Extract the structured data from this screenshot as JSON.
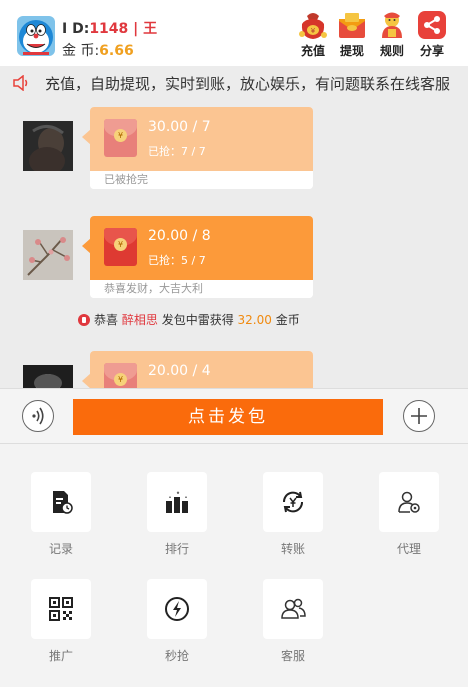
{
  "header": {
    "id_label": "I D:",
    "id_value": "1148",
    "separator": "|",
    "name": "王",
    "coins_label": "金 币:",
    "coins_value": "6.66",
    "buttons": [
      {
        "label": "充值",
        "icon": "recharge-bag-icon"
      },
      {
        "label": "提现",
        "icon": "withdraw-envelope-icon"
      },
      {
        "label": "规则",
        "icon": "rules-character-icon"
      },
      {
        "label": "分享",
        "icon": "share-icon"
      }
    ]
  },
  "marquee": {
    "icon": "speaker-icon",
    "text": "充值，自助提现，实时到账，放心娱乐，有问题联系在线客服"
  },
  "messages": [
    {
      "amount": "30.00 / 7",
      "grabbed": "已抢：7 / 7",
      "status": "已被抢完"
    },
    {
      "amount": "20.00 / 8",
      "grabbed": "已抢：5 / 7",
      "status": "恭喜发财，大吉大利"
    },
    {
      "amount": "20.00 / 4"
    }
  ],
  "notice": {
    "prefix": "恭喜",
    "name": "醉相思",
    "middle": "发包中雷获得",
    "amount": "32.00",
    "suffix": "金币"
  },
  "sendbar": {
    "send_label": "点击发包"
  },
  "menu": [
    {
      "label": "记录",
      "icon": "record-icon"
    },
    {
      "label": "排行",
      "icon": "ranking-icon"
    },
    {
      "label": "转账",
      "icon": "transfer-icon"
    },
    {
      "label": "代理",
      "icon": "agent-icon"
    },
    {
      "label": "推广",
      "icon": "qrcode-icon"
    },
    {
      "label": "秒抢",
      "icon": "lightning-icon"
    },
    {
      "label": "客服",
      "icon": "customer-service-icon"
    }
  ],
  "colors": {
    "accent": "#fa6b0c",
    "bubble_light": "#fbc592",
    "bubble_orange": "#fc9a3a",
    "highlight_red": "#e0383e",
    "coin_gold": "#f0a020"
  }
}
